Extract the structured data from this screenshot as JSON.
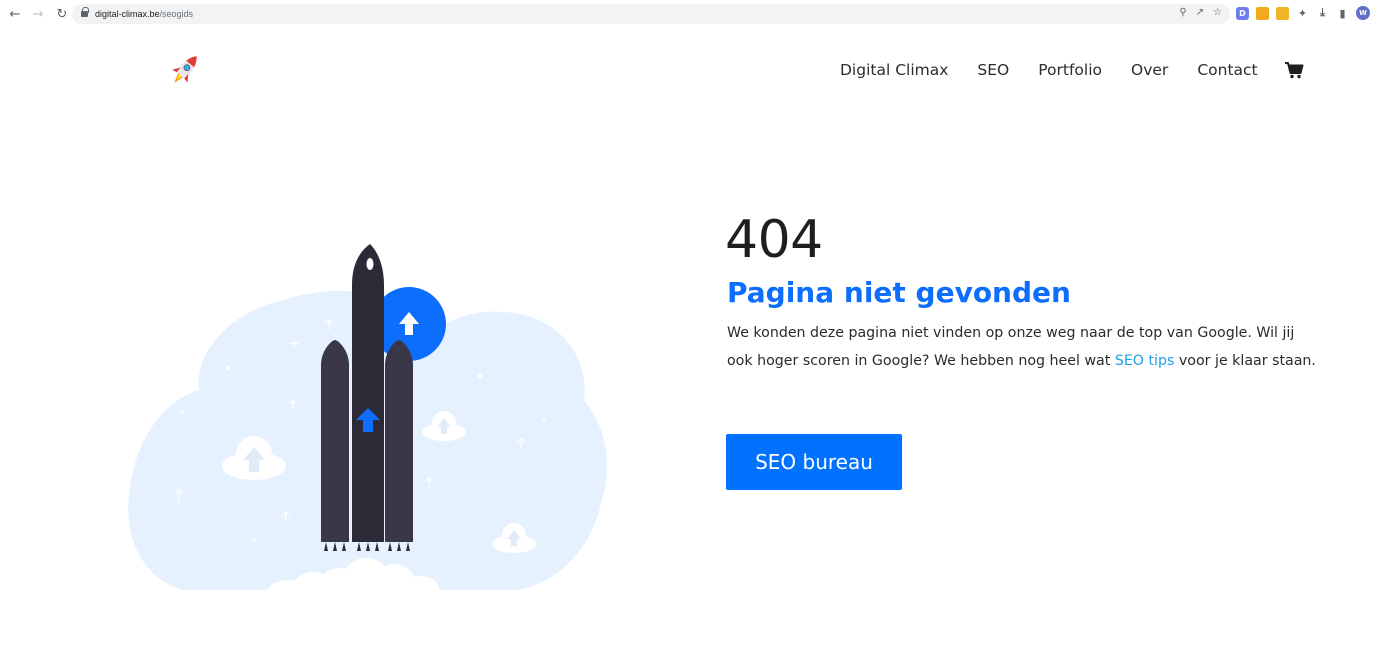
{
  "browser": {
    "url_host": "digital-climax.be",
    "url_path": "/seogids",
    "avatar_letter": "W"
  },
  "header": {
    "nav": [
      "Digital Climax",
      "SEO",
      "Portfolio",
      "Over",
      "Contact"
    ],
    "cart_icon": "shopping-cart-icon",
    "logo_icon": "rocket-icon"
  },
  "error": {
    "code": "404",
    "title": "Pagina niet gevonden",
    "text_before": "We konden deze pagina niet vinden op onze weg naar de top van Google. Wil jij ook hoger scoren in Google? We hebben nog heel wat ",
    "link_text": "SEO tips",
    "text_after": " voor je klaar staan.",
    "button_label": "SEO bureau"
  },
  "colors": {
    "accent": "#0072ff",
    "title": "#0d6efd",
    "link": "#1fa1e6",
    "cloud": "#e6f1ff",
    "rocket": "#33313f"
  }
}
